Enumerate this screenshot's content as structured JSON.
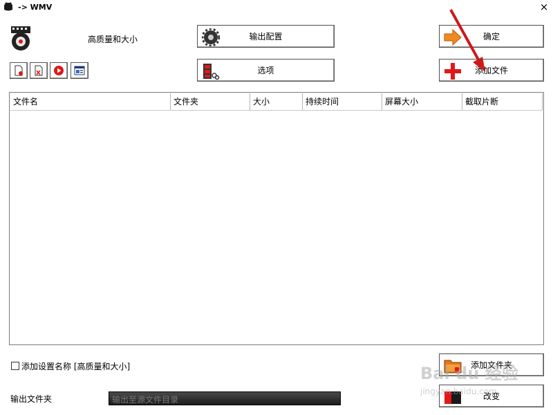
{
  "window": {
    "title": "-> WMV",
    "close_glyph": "×"
  },
  "profile": {
    "name": "高质量和大小",
    "icon": "film-reel-icon"
  },
  "toolbar": {
    "output_config_label": "输出配置",
    "options_label": "选项",
    "ok_label": "确定",
    "add_file_label": "添加文件",
    "add_folder_label": "添加文件夹",
    "change_label": "改变"
  },
  "small_buttons": [
    {
      "name": "remove-file-button",
      "icon": "doc-remove-icon"
    },
    {
      "name": "clear-list-button",
      "icon": "doc-clear-icon"
    },
    {
      "name": "play-button",
      "icon": "play-icon"
    },
    {
      "name": "media-info-button",
      "icon": "info-window-icon"
    }
  ],
  "file_list": {
    "columns": [
      "文件名",
      "文件夹",
      "大小",
      "持续时间",
      "屏幕大小",
      "截取片断"
    ],
    "rows": []
  },
  "options": {
    "add_setting_name_label": "添加设置名称 [高质量和大小]",
    "add_setting_name_checked": false
  },
  "output": {
    "label": "输出文件夹",
    "value": "输出至源文件目录"
  },
  "watermark": {
    "line1": "Bai du 经验",
    "line2": "jingyan.baidu.com"
  },
  "colors": {
    "accent_red": "#e01818",
    "arrow_orange": "#f08a20",
    "annotation_arrow": "#cc1a1a"
  }
}
